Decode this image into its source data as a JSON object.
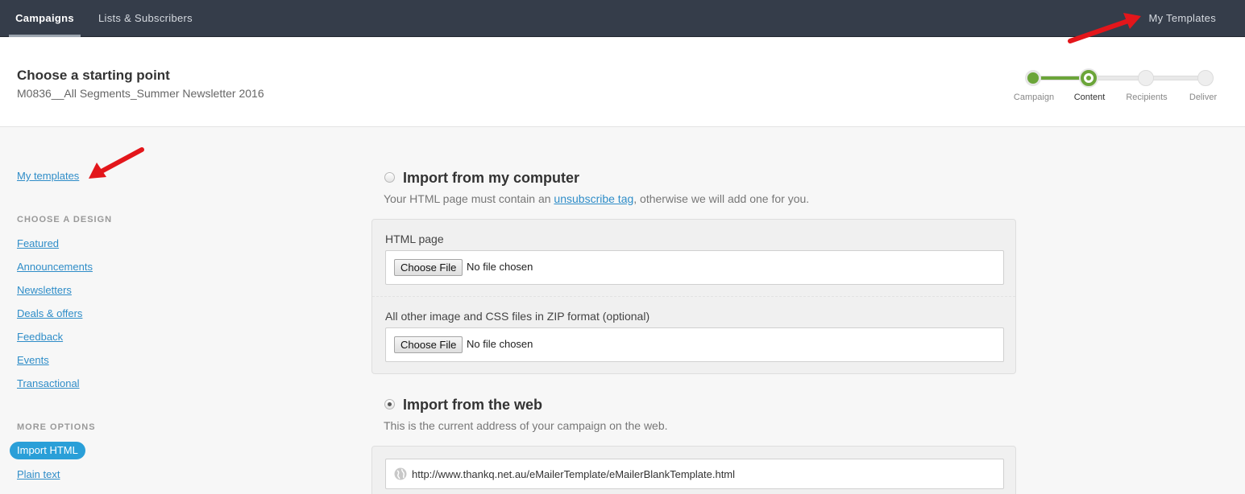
{
  "nav": {
    "tabs": [
      {
        "label": "Campaigns",
        "active": true
      },
      {
        "label": "Lists & Subscribers",
        "active": false
      }
    ],
    "right_link": "My Templates"
  },
  "header": {
    "title": "Choose a starting point",
    "subtitle": "M0836__All Segments_Summer Newsletter 2016"
  },
  "progress": {
    "steps": [
      "Campaign",
      "Content",
      "Recipients",
      "Deliver"
    ],
    "current_step": "Content",
    "completed_fraction": 0.33
  },
  "sidebar": {
    "top_link": "My templates",
    "design_heading": "CHOOSE A DESIGN",
    "design_links": [
      "Featured",
      "Announcements",
      "Newsletters",
      "Deals & offers",
      "Feedback",
      "Events",
      "Transactional"
    ],
    "options_heading": "MORE OPTIONS",
    "active_option": "Import HTML",
    "other_option": "Plain text"
  },
  "import_computer": {
    "title": "Import from my computer",
    "desc_before": "Your HTML page must contain an ",
    "desc_link": "unsubscribe tag",
    "desc_after": ", otherwise we will add one for you.",
    "selected": false,
    "html_label": "HTML page",
    "zip_label": "All other image and CSS files in ZIP format (optional)",
    "choose_file": "Choose File",
    "no_file": "No file chosen"
  },
  "import_web": {
    "title": "Import from the web",
    "desc": "This is the current address of your campaign on the web.",
    "selected": true,
    "url": "http://www.thankq.net.au/eMailerTemplate/eMailerBlankTemplate.html"
  },
  "colors": {
    "nav_bg": "#353d4a",
    "accent_green": "#6ba539",
    "link_blue": "#2f8dc8",
    "pill_blue": "#2a9fd8",
    "arrow_red": "#e3161b"
  }
}
